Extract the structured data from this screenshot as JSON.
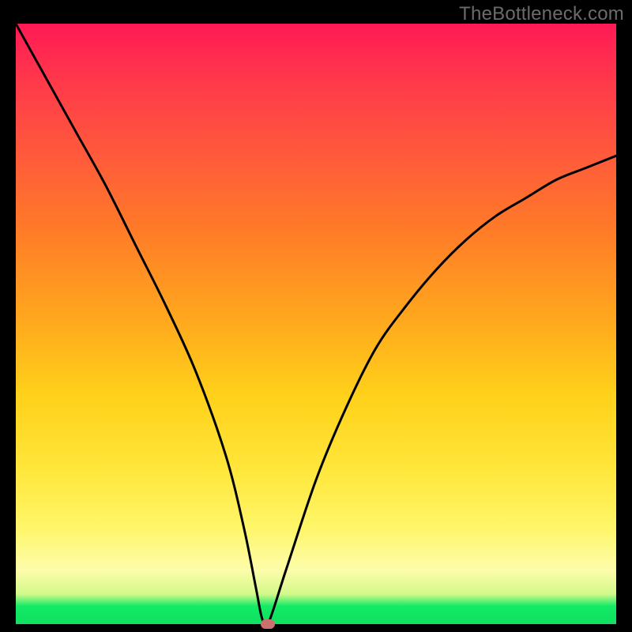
{
  "watermark": "TheBottleneck.com",
  "colors": {
    "frame": "#000000",
    "curve": "#000000",
    "marker": "#cc6f6f",
    "gradient_top": "#ff1a55",
    "gradient_mid1": "#ff7a28",
    "gradient_mid2": "#ffd11a",
    "gradient_mid3": "#fdfdaa",
    "gradient_bottom": "#13eb66"
  },
  "chart_data": {
    "type": "line",
    "title": "",
    "xlabel": "",
    "ylabel": "",
    "xlim": [
      0,
      100
    ],
    "ylim": [
      0,
      100
    ],
    "note": "Values are approximate, read from pixel positions; y=0 is the bottom green baseline, y=100 is the top.",
    "series": [
      {
        "name": "curve",
        "x": [
          0,
          5,
          10,
          15,
          20,
          25,
          30,
          35,
          38,
          40,
          41,
          42,
          45,
          50,
          55,
          60,
          65,
          70,
          75,
          80,
          85,
          90,
          95,
          100
        ],
        "values": [
          100,
          91,
          82,
          73,
          63,
          53,
          42,
          28,
          16,
          6,
          1,
          0,
          9,
          24,
          36,
          46,
          53,
          59,
          64,
          68,
          71,
          74,
          76,
          78
        ]
      }
    ],
    "marker": {
      "x": 42,
      "y": 0
    },
    "background_bands": [
      {
        "label": "red",
        "from_y": 90,
        "to_y": 100
      },
      {
        "label": "orange",
        "from_y": 50,
        "to_y": 90
      },
      {
        "label": "yellow",
        "from_y": 10,
        "to_y": 50
      },
      {
        "label": "green",
        "from_y": 0,
        "to_y": 4
      }
    ]
  }
}
